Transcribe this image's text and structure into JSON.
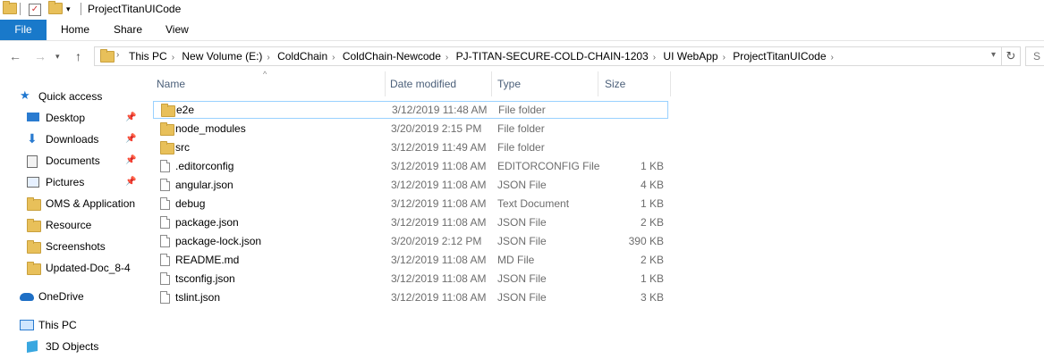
{
  "window": {
    "title": "ProjectTitanUICode"
  },
  "ribbon": {
    "tabs": [
      "File",
      "Home",
      "Share",
      "View"
    ]
  },
  "address": {
    "crumbs": [
      "This PC",
      "New Volume (E:)",
      "ColdChain",
      "ColdChain-Newcode",
      "PJ-TITAN-SECURE-COLD-CHAIN-1203",
      "UI WebApp",
      "ProjectTitanUICode"
    ]
  },
  "nav": {
    "quick_access": "Quick access",
    "items": [
      {
        "label": "Desktop",
        "icon": "desktop-icon",
        "pinned": true
      },
      {
        "label": "Downloads",
        "icon": "downloads-icon",
        "pinned": true
      },
      {
        "label": "Documents",
        "icon": "documents-icon",
        "pinned": true
      },
      {
        "label": "Pictures",
        "icon": "pictures-icon",
        "pinned": true
      },
      {
        "label": "OMS & Application",
        "icon": "folder-icon",
        "pinned": false
      },
      {
        "label": "Resource",
        "icon": "folder-icon",
        "pinned": false
      },
      {
        "label": "Screenshots",
        "icon": "folder-icon",
        "pinned": false
      },
      {
        "label": "Updated-Doc_8-4",
        "icon": "folder-icon",
        "pinned": false
      }
    ],
    "onedrive": "OneDrive",
    "this_pc": "This PC",
    "objects3d": "3D Objects"
  },
  "columns": {
    "name": "Name",
    "date": "Date modified",
    "type": "Type",
    "size": "Size"
  },
  "files": [
    {
      "name": "e2e",
      "date": "3/12/2019 11:48 AM",
      "type": "File folder",
      "size": "",
      "kind": "folder"
    },
    {
      "name": "node_modules",
      "date": "3/20/2019 2:15 PM",
      "type": "File folder",
      "size": "",
      "kind": "folder"
    },
    {
      "name": "src",
      "date": "3/12/2019 11:49 AM",
      "type": "File folder",
      "size": "",
      "kind": "folder"
    },
    {
      "name": ".editorconfig",
      "date": "3/12/2019 11:08 AM",
      "type": "EDITORCONFIG File",
      "size": "1 KB",
      "kind": "file"
    },
    {
      "name": "angular.json",
      "date": "3/12/2019 11:08 AM",
      "type": "JSON File",
      "size": "4 KB",
      "kind": "file"
    },
    {
      "name": "debug",
      "date": "3/12/2019 11:08 AM",
      "type": "Text Document",
      "size": "1 KB",
      "kind": "file"
    },
    {
      "name": "package.json",
      "date": "3/12/2019 11:08 AM",
      "type": "JSON File",
      "size": "2 KB",
      "kind": "file"
    },
    {
      "name": "package-lock.json",
      "date": "3/20/2019 2:12 PM",
      "type": "JSON File",
      "size": "390 KB",
      "kind": "file"
    },
    {
      "name": "README.md",
      "date": "3/12/2019 11:08 AM",
      "type": "MD File",
      "size": "2 KB",
      "kind": "file"
    },
    {
      "name": "tsconfig.json",
      "date": "3/12/2019 11:08 AM",
      "type": "JSON File",
      "size": "1 KB",
      "kind": "file"
    },
    {
      "name": "tslint.json",
      "date": "3/12/2019 11:08 AM",
      "type": "JSON File",
      "size": "3 KB",
      "kind": "file"
    }
  ],
  "colors": {
    "file_tab": "#1979ca",
    "selection_border": "#99d1ff",
    "header_text": "#4c607a"
  }
}
